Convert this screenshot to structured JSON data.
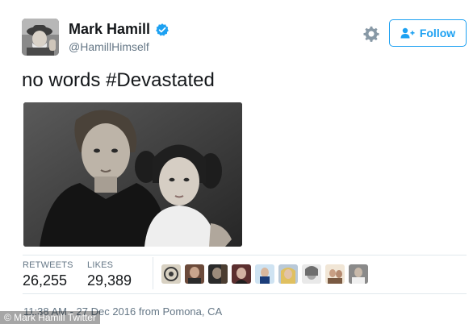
{
  "author": {
    "display_name": "Mark Hamill",
    "handle": "@HamillHimself",
    "verified": true
  },
  "actions": {
    "follow_label": "Follow"
  },
  "tweet": {
    "text_plain": "no words ",
    "hashtag": "#Devastated"
  },
  "stats": {
    "retweets_label": "RETWEETS",
    "retweets_value": "26,255",
    "likes_label": "LIKES",
    "likes_value": "29,389"
  },
  "timestamp": "11:38 AM - 27 Dec 2016 from Pomona, CA",
  "watermark": "© Mark Hamill Twitter",
  "colors": {
    "brand_blue": "#1da1f2",
    "muted_text": "#657786",
    "divider": "#e1e8ed"
  }
}
